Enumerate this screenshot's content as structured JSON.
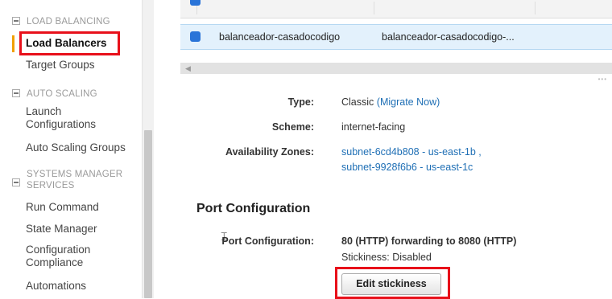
{
  "sidebar": {
    "sections": [
      {
        "title": "LOAD BALANCING",
        "items": [
          "Load Balancers",
          "Target Groups"
        ]
      },
      {
        "title": "AUTO SCALING",
        "items": [
          "Launch Configurations",
          "Auto Scaling Groups"
        ]
      },
      {
        "title": "SYSTEMS MANAGER SERVICES",
        "items": [
          "Run Command",
          "State Manager",
          "Configuration Compliance",
          "Automations"
        ]
      }
    ],
    "active_item": "Load Balancers"
  },
  "table": {
    "selected_row": {
      "name": "balanceador-casadocodigo",
      "dns_name": "balanceador-casadocodigo-..."
    }
  },
  "details": {
    "type_label": "Type:",
    "type_value": "Classic",
    "migrate_link": "(Migrate Now)",
    "scheme_label": "Scheme:",
    "scheme_value": "internet-facing",
    "zones_label": "Availability Zones:",
    "zones": [
      "subnet-6cd4b808 - us-east-1b ,",
      "subnet-9928f6b6 - us-east-1c"
    ]
  },
  "port_config": {
    "heading": "Port Configuration",
    "label": "Port Configuration:",
    "forwarding": "80 (HTTP) forwarding to 8080 (HTTP)",
    "stickiness": "Stickiness: Disabled",
    "edit_button": "Edit stickiness"
  },
  "colors": {
    "highlight_box": "#e8101a",
    "active_marker": "#f0a000",
    "link": "#1f6fb5",
    "selected_row": "#e3f1fc"
  }
}
